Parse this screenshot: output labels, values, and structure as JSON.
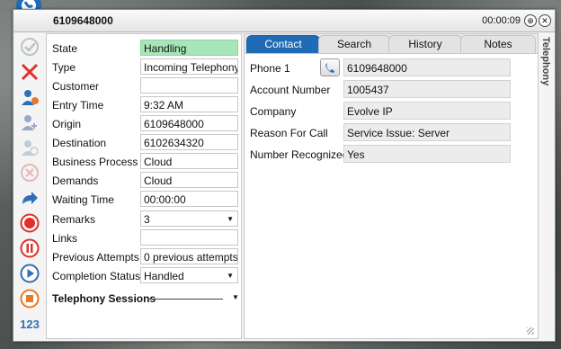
{
  "window": {
    "title": "6109648000",
    "timer": "00:00:09",
    "pin_icon": "pin-icon",
    "close_icon": "close-icon"
  },
  "toolbar": {
    "items": [
      {
        "icon": "accept-check-icon",
        "color": "#b9c7b9"
      },
      {
        "icon": "reject-x-icon",
        "color": "#e0302a"
      },
      {
        "icon": "user-settings-icon",
        "color": "#2f6fb5"
      },
      {
        "icon": "user-add-icon",
        "color": "#9aa9c4"
      },
      {
        "icon": "user-remove-icon",
        "color": "#c3cad7"
      },
      {
        "icon": "cancel-circle-icon",
        "color": "#e6b7b7"
      },
      {
        "icon": "forward-arrow-icon",
        "color": "#2f6fb5"
      },
      {
        "icon": "record-icon",
        "color": "#e0302a"
      },
      {
        "icon": "pause-icon",
        "color": "#e0302a"
      },
      {
        "icon": "play-icon",
        "color": "#2f6fb5"
      },
      {
        "icon": "stop-icon",
        "color": "#e8782a"
      }
    ],
    "keypad_label": "123"
  },
  "interaction": {
    "fields": [
      {
        "label": "State",
        "value": "Handling",
        "style": "green"
      },
      {
        "label": "Type",
        "value": "Incoming Telephony"
      },
      {
        "label": "Customer",
        "value": ""
      },
      {
        "label": "Entry Time",
        "value": "9:32 AM"
      },
      {
        "label": "Origin",
        "value": "6109648000"
      },
      {
        "label": "Destination",
        "value": "6102634320"
      },
      {
        "label": "Business Process",
        "value": "Cloud"
      },
      {
        "label": "Demands",
        "value": "Cloud"
      },
      {
        "label": "Waiting Time",
        "value": "00:00:00"
      },
      {
        "label": "Remarks",
        "value": "3",
        "dropdown": true
      },
      {
        "label": "Links",
        "value": ""
      },
      {
        "label": "Previous Attempts",
        "value": "0 previous attempts"
      },
      {
        "label": "Completion Status",
        "value": "Handled",
        "dropdown": true
      }
    ],
    "sessions_label": "Telephony Sessions"
  },
  "tabs": [
    "Contact",
    "Search",
    "History",
    "Notes"
  ],
  "active_tab": "Contact",
  "contact": {
    "fields": [
      {
        "label": "Phone 1",
        "value": "6109648000",
        "has_phone_button": true
      },
      {
        "label": "Account Number",
        "value": "1005437"
      },
      {
        "label": "Company",
        "value": "Evolve IP"
      },
      {
        "label": "Reason For Call",
        "value": "Service Issue: Server"
      },
      {
        "label": "Number Recognized",
        "value": "Yes"
      }
    ]
  },
  "side_tab": "Telephony",
  "colors": {
    "accent": "#1f6bb5",
    "state_green": "#a6e6b8"
  }
}
